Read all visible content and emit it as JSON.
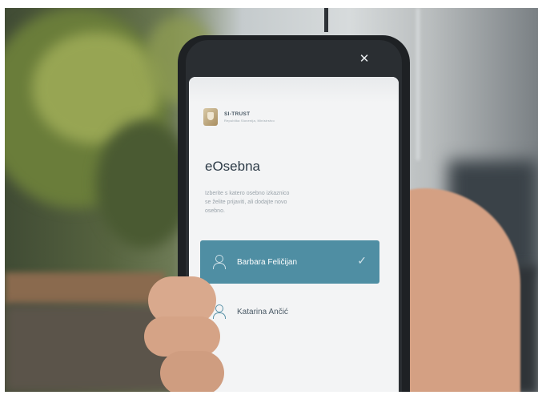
{
  "app": {
    "brand_name": "SI-TRUST",
    "brand_subtitle": "Republika Slovenija, Ministrstvo"
  },
  "screen": {
    "title": "eOsebna",
    "description_lines": [
      "Izberite s katero osebno izkaznico",
      "se želite prijaviti, ali dodajte novo",
      "osebno."
    ]
  },
  "accounts": [
    {
      "name": "Barbara Feličijan",
      "selected": true
    },
    {
      "name": "Katarina Ančić",
      "selected": false
    }
  ],
  "icons": {
    "close": "close-icon",
    "user": "user-icon",
    "check": "check-icon",
    "logo": "shield-logo-icon"
  },
  "colors": {
    "accent": "#4f8ea3",
    "screen_bg": "#f3f4f5",
    "phone_body": "#1e2124"
  }
}
